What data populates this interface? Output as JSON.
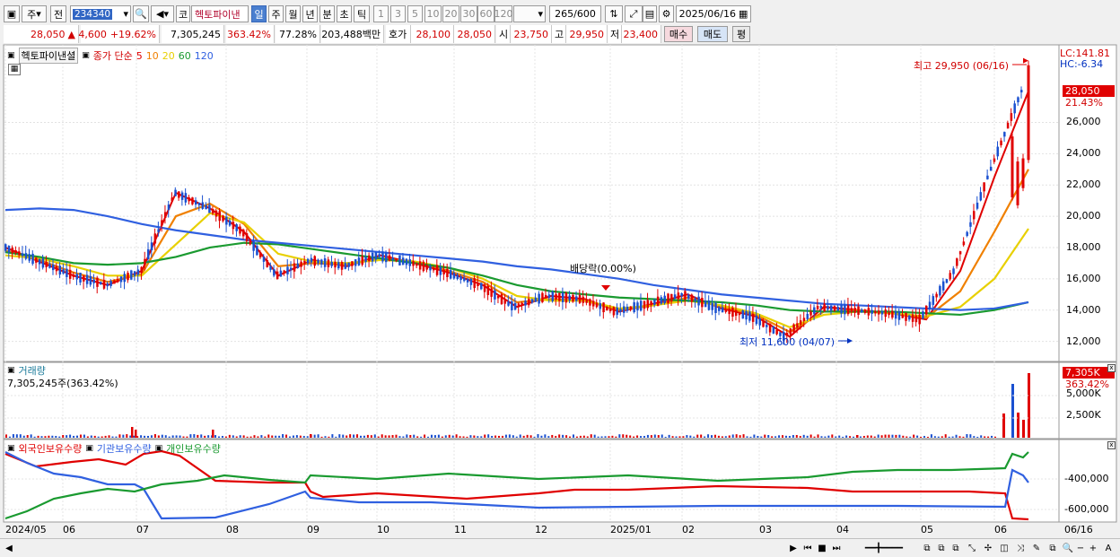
{
  "toolbar": {
    "market_label": "주",
    "prev_label": "전",
    "code": "234340",
    "stock_tab": "코",
    "stock_name": "헥토파이낸",
    "periods": [
      "일",
      "주",
      "월",
      "년",
      "분",
      "초",
      "틱"
    ],
    "active_period": "일",
    "intervals": [
      "1",
      "3",
      "5",
      "10",
      "20",
      "30",
      "60",
      "120"
    ],
    "count": "265",
    "count_total": "/600",
    "date": "2025/06/16"
  },
  "info": {
    "price": "28,050",
    "change_sign": "▲",
    "change": "4,600",
    "change_pct": "+19.62%",
    "volume": "7,305,245",
    "volume_pct": "363.42%",
    "turnover": "77.28%",
    "amount": "203,488백만",
    "bid_label": "호가",
    "bid": "28,100",
    "ask": "28,050",
    "open_label": "시",
    "open": "23,750",
    "high_label": "고",
    "high": "29,950",
    "low_label": "저",
    "low": "23,400",
    "buy_button": "매수",
    "sell_button": "매도",
    "eval_button": "평"
  },
  "price_panel": {
    "stock_label": "헥토파이낸셜",
    "indicator_label": "종가 단순",
    "ma_labels": [
      "5",
      "10",
      "20",
      "60",
      "120"
    ],
    "ma_colors": [
      "#e00000",
      "#f08000",
      "#e8d000",
      "#1a9a30",
      "#3060e0"
    ],
    "lc_label": "LC:141.81",
    "hc_label": "HC:-6.34",
    "max_note": "최고 29,950 (06/16)",
    "min_note": "최저 11,600 (04/07)",
    "dividend_note": "배당락(0.00%)",
    "last_price_tag": "28,050",
    "last_price_pct": "21.43%",
    "y_ticks": [
      "26,000",
      "24,000",
      "22,000",
      "20,000",
      "18,000",
      "16,000",
      "14,000",
      "12,000"
    ]
  },
  "volume_panel": {
    "title": "거래량",
    "value_label": "7,305,245주(363.42%)",
    "tag": "7,305K",
    "tag_pct": "363.42%",
    "y_ticks": [
      "5,000K",
      "2,500K"
    ]
  },
  "holdings_panel": {
    "legend": [
      "외국인보유수량",
      "기관보유수량",
      "개인보유수량"
    ],
    "legend_colors": [
      "#e00000",
      "#3060e0",
      "#1a9a30"
    ],
    "y_ticks": [
      "-400,000",
      "-600,000"
    ]
  },
  "x_axis": {
    "labels": [
      "2024/05",
      "06",
      "07",
      "08",
      "09",
      "10",
      "11",
      "12",
      "2025/01",
      "02",
      "03",
      "04",
      "05",
      "06"
    ],
    "last_label": "06/16"
  },
  "chart_data": {
    "type": "candlestick",
    "title": "헥토파이낸셜",
    "y_range": [
      11000,
      30500
    ],
    "series_ma": [
      {
        "name": "5",
        "values": [
          18000,
          17100,
          16200,
          15600,
          16500,
          21500,
          20500,
          19000,
          16200,
          17200,
          16800,
          17500,
          17000,
          16400,
          15600,
          14200,
          14900,
          14700,
          13900,
          14400,
          15000,
          14100,
          13600,
          12300,
          14200,
          14000,
          13800,
          13400,
          16500,
          22500,
          28000
        ]
      },
      {
        "name": "10",
        "values": [
          17800,
          17200,
          16400,
          15800,
          16300,
          20000,
          20800,
          19500,
          16800,
          17000,
          16900,
          17300,
          17100,
          16500,
          15800,
          14500,
          14700,
          14600,
          14000,
          14300,
          14800,
          14200,
          13700,
          12600,
          13900,
          14000,
          13800,
          13500,
          15200,
          19000,
          23000
        ]
      },
      {
        "name": "20",
        "values": [
          17500,
          17300,
          16800,
          16200,
          16200,
          18200,
          20200,
          19600,
          17600,
          17100,
          17000,
          17200,
          17100,
          16700,
          16000,
          14900,
          14600,
          14600,
          14100,
          14300,
          14600,
          14300,
          13800,
          12900,
          13700,
          13900,
          13800,
          13600,
          14200,
          16000,
          19200
        ]
      },
      {
        "name": "60",
        "values": [
          17700,
          17400,
          17000,
          16900,
          17000,
          17400,
          18000,
          18300,
          18200,
          17900,
          17600,
          17300,
          17000,
          16700,
          16200,
          15600,
          15200,
          15000,
          14800,
          14700,
          14600,
          14500,
          14300,
          14000,
          13900,
          13900,
          13900,
          13800,
          13700,
          14000,
          14500
        ]
      },
      {
        "name": "120",
        "values": [
          20400,
          20500,
          20400,
          20000,
          19500,
          19100,
          18800,
          18500,
          18300,
          18100,
          17900,
          17700,
          17500,
          17300,
          17100,
          16800,
          16600,
          16300,
          16000,
          15600,
          15300,
          15000,
          14800,
          14600,
          14400,
          14300,
          14200,
          14100,
          14000,
          14100,
          14500
        ]
      }
    ],
    "max": {
      "date": "06/16",
      "value": 29950
    },
    "min": {
      "date": "04/07",
      "value": 11600
    },
    "last": 28050
  }
}
